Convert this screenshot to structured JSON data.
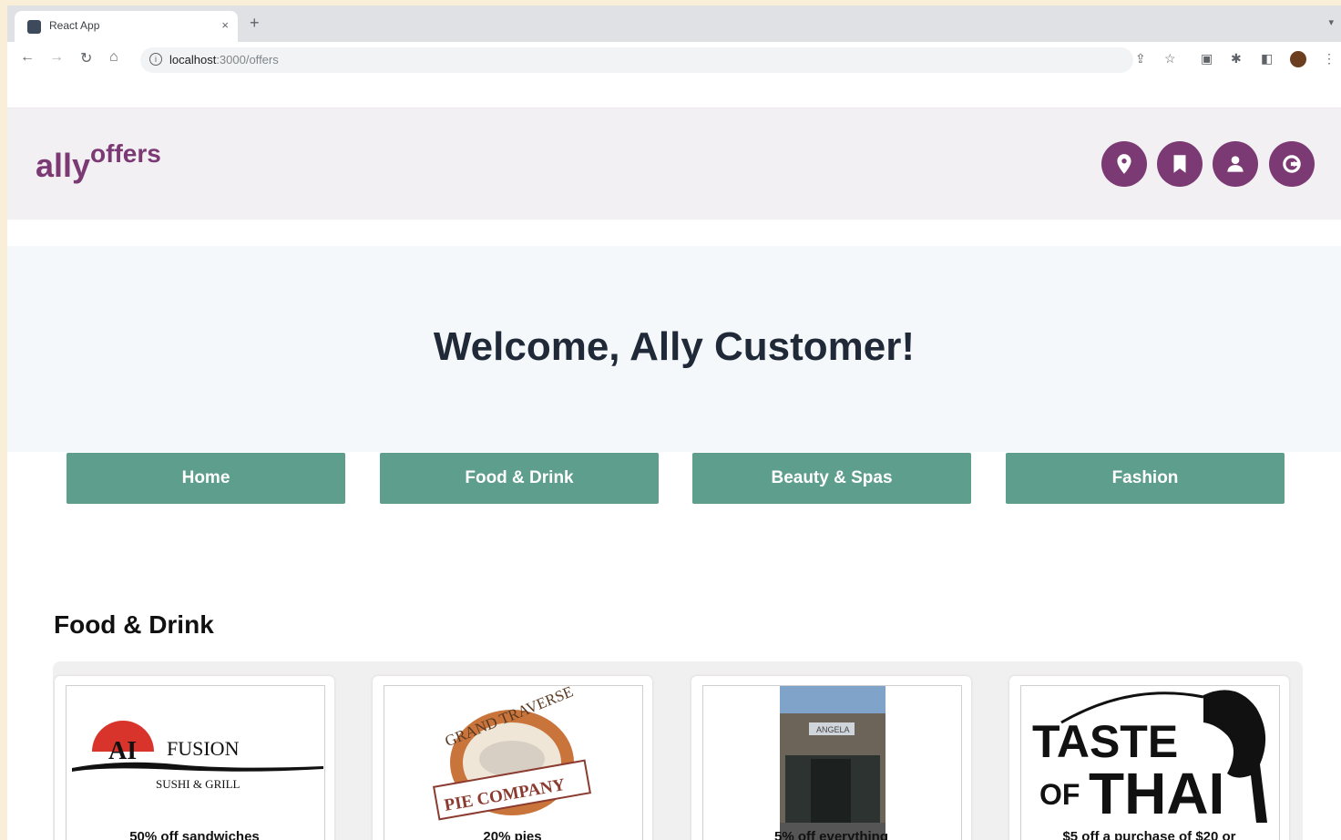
{
  "browser": {
    "tab_title": "React App",
    "tab_close": "×",
    "new_tab": "+",
    "url_host": "localhost",
    "url_path": ":3000/offers",
    "buttons": {
      "back": "←",
      "forward": "→",
      "reload": "↻",
      "home": "⌂"
    }
  },
  "app": {
    "logo_main": "ally",
    "logo_super": "offers",
    "header_buttons": [
      {
        "name": "location",
        "icon": "map-pin-icon"
      },
      {
        "name": "saved",
        "icon": "bookmark-icon"
      },
      {
        "name": "profile",
        "icon": "user-icon"
      },
      {
        "name": "logout",
        "icon": "logout-icon"
      }
    ],
    "welcome": "Welcome, Ally Customer!",
    "categories": [
      "Home",
      "Food & Drink",
      "Beauty & Spas",
      "Fashion"
    ],
    "section_title": "Food & Drink",
    "cards": [
      {
        "brand_line1": "AI",
        "brand_line2": "FUSION",
        "brand_line3": "SUSHI & GRILL",
        "offer": "50% off sandwiches"
      },
      {
        "brand_line1": "GRAND TRAVERSE",
        "brand_line2": "PIE COMPANY",
        "offer": "20% pies"
      },
      {
        "sign": "ANGELA",
        "offer": "5% off everything"
      },
      {
        "brand_line1": "TASTE",
        "brand_line2": "OF",
        "brand_line3": "THAI",
        "offer": "$5 off a purchase of $20 or"
      }
    ]
  },
  "colors": {
    "brand": "#7b3a73",
    "button_green": "#5e9e8c",
    "heading": "#1f2937"
  }
}
